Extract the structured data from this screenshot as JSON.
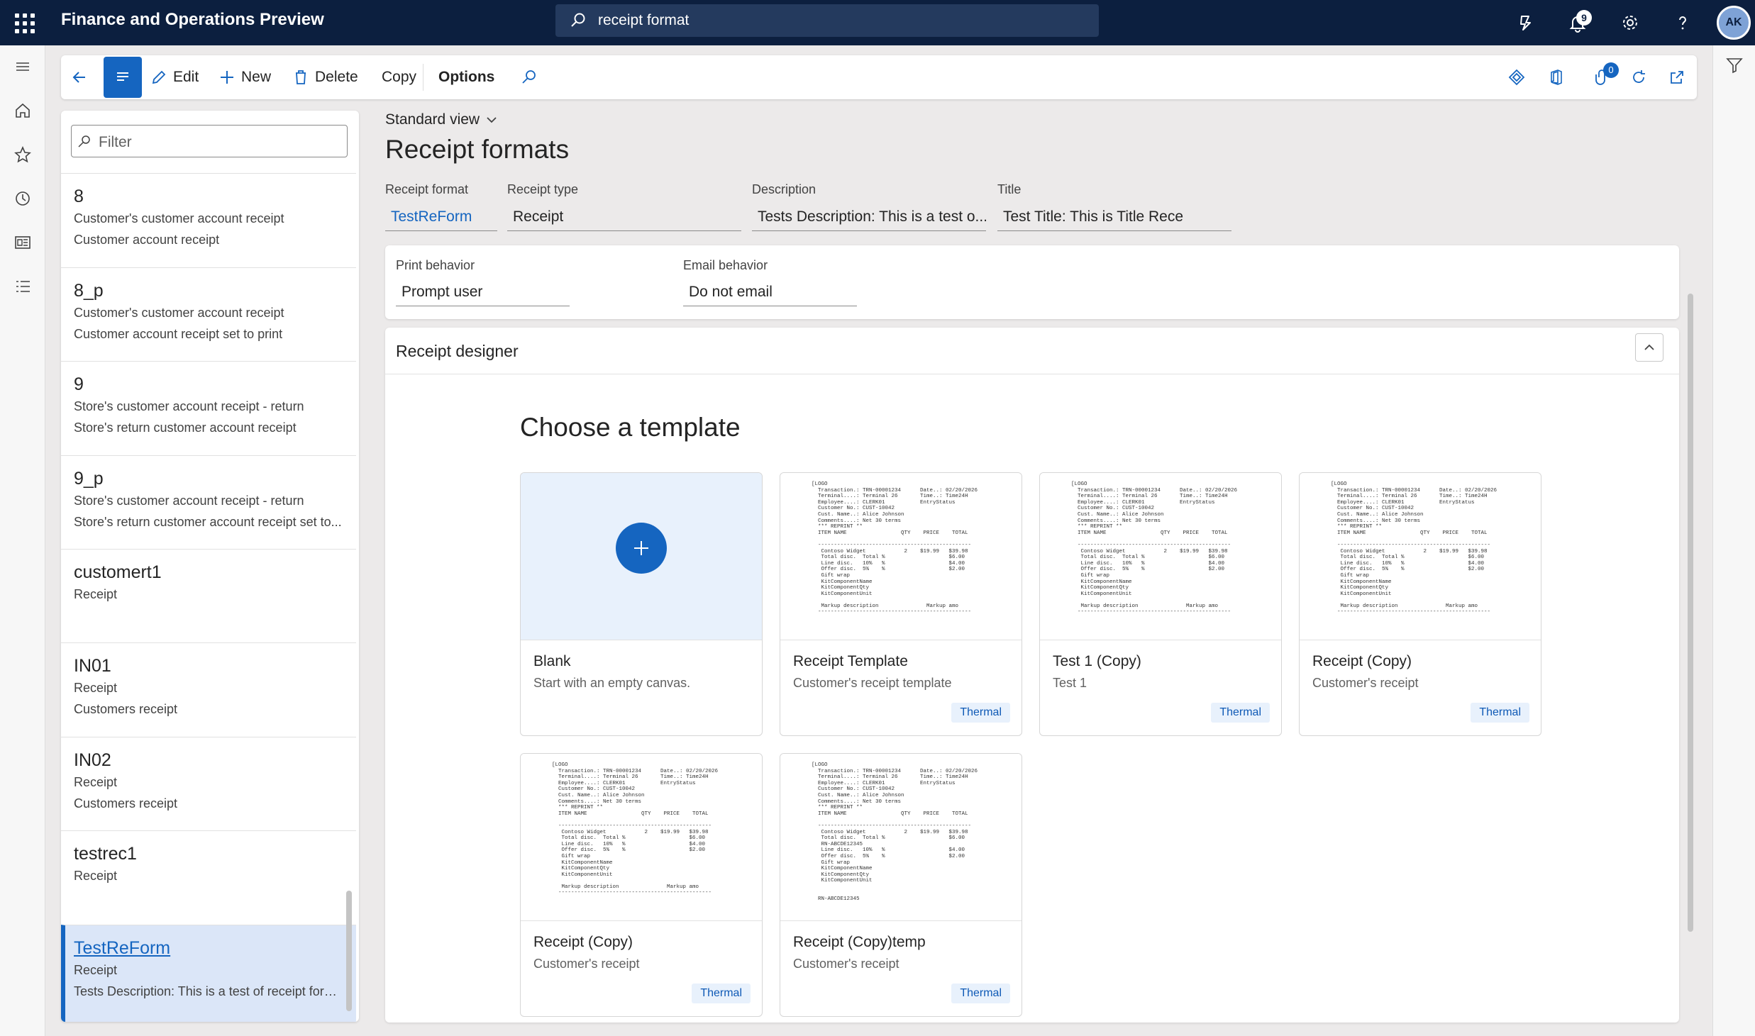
{
  "app": {
    "title": "Finance and Operations Preview",
    "search_value": "receipt format",
    "notifications_count": "9",
    "avatar_initials": "AK"
  },
  "actions": {
    "edit": "Edit",
    "new": "New",
    "delete": "Delete",
    "copy": "Copy",
    "options": "Options",
    "attach_count": "0"
  },
  "list": {
    "filter_placeholder": "Filter",
    "items": [
      {
        "title": "8",
        "line1": "Customer's customer account receipt",
        "line2": "Customer account receipt"
      },
      {
        "title": "8_p",
        "line1": "Customer's customer account receipt",
        "line2": "Customer account receipt set to print"
      },
      {
        "title": "9",
        "line1": "Store's customer account receipt - return",
        "line2": "Store's return customer account receipt"
      },
      {
        "title": "9_p",
        "line1": "Store's customer account receipt - return",
        "line2": "Store's return customer account receipt set to..."
      },
      {
        "title": "customert1",
        "line1": "Receipt",
        "line2": ""
      },
      {
        "title": "IN01",
        "line1": "Receipt",
        "line2": "Customers receipt"
      },
      {
        "title": "IN02",
        "line1": "Receipt",
        "line2": "Customers receipt"
      },
      {
        "title": "testrec1",
        "line1": "Receipt",
        "line2": ""
      },
      {
        "title": "TestReForm",
        "line1": "Receipt",
        "line2": "Tests Description: This is a test of receipt form..."
      }
    ]
  },
  "page": {
    "view": "Standard view",
    "title": "Receipt formats",
    "fields": {
      "receipt_format_label": "Receipt format",
      "receipt_format": "TestReForm",
      "receipt_type_label": "Receipt type",
      "receipt_type": "Receipt",
      "description_label": "Description",
      "description": "Tests Description: This is a test o...",
      "title_label": "Title",
      "title": "Test Title: This is Title Rece",
      "print_behavior_label": "Print behavior",
      "print_behavior": "Prompt user",
      "email_behavior_label": "Email behavior",
      "email_behavior": "Do not email"
    },
    "designer": {
      "header": "Receipt designer",
      "choose": "Choose a template",
      "templates": [
        {
          "name": "Blank",
          "desc": "Start with an empty canvas.",
          "tag": ""
        },
        {
          "name": "Receipt Template",
          "desc": "Customer's receipt template",
          "tag": "Thermal"
        },
        {
          "name": "Test 1 (Copy)",
          "desc": "Test 1",
          "tag": "Thermal"
        },
        {
          "name": "Receipt (Copy)",
          "desc": "Customer's receipt",
          "tag": "Thermal"
        },
        {
          "name": "Receipt (Copy)",
          "desc": "Customer's receipt",
          "tag": "Thermal"
        },
        {
          "name": "Receipt (Copy)temp",
          "desc": "Customer's receipt",
          "tag": "Thermal"
        }
      ],
      "preview_text": "[LOGO\n  Transaction.: TRN-00001234      Date..: 02/20/2026\n  Terminal....: Terminal 26       Time..: Time24H\n  Employee....: CLERK01           EntryStatus\n  Customer No.: CUST-10042\n  Cust. Name..: Alice Johnson\n  Comments....: Net 30 terms\n  *** REPRINT **\n  ITEM NAME                 QTY    PRICE    TOTAL\n\n  ------------------------------------------------\n   Contoso Widget            2    $19.99   $39.98\n   Total disc.  Total %                    $6.00\n   Line disc.   10%   %                    $4.00\n   Offer disc.  5%    %                    $2.00\n   Gift wrap\n   KitComponentName\n   KitComponentQty\n   KitComponentUnit\n\n   Markup description               Markup amo\n  ------------------------------------------------",
      "preview_text_alt": "[LOGO\n  Transaction.: TRN-00001234      Date..: 02/20/2026\n  Terminal....: Terminal 26       Time..: Time24H\n  Employee....: CLERK01           EntryStatus\n  Customer No.: CUST-10042\n  Cust. Name..: Alice Johnson\n  Comments....: Net 30 terms\n  *** REPRINT **\n  ITEM NAME                 QTY    PRICE    TOTAL\n\n  ------------------------------------------------\n   Contoso Widget            2    $19.99   $39.98\n   Total disc.  Total %                    $6.00\n   RN-ABCDE12345\n   Line disc.   10%   %                    $4.00\n   Offer disc.  5%    %                    $2.00\n   Gift wrap\n   KitComponentName\n   KitComponentQty\n   KitComponentUnit\n\n\n  RN-ABCDE12345"
    }
  }
}
